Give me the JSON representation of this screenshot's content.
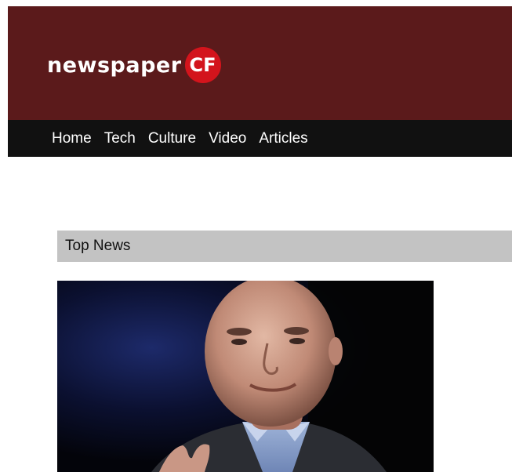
{
  "masthead": {
    "logo_word": "newspaper",
    "logo_badge": "CF",
    "colors": {
      "background": "#5b1a1b",
      "badge": "#d3141c",
      "text": "#ffffff"
    }
  },
  "nav": {
    "items": [
      {
        "label": "Home"
      },
      {
        "label": "Tech"
      },
      {
        "label": "Culture"
      },
      {
        "label": "Video"
      },
      {
        "label": "Articles"
      }
    ],
    "colors": {
      "background": "#111111",
      "text": "#ffffff"
    }
  },
  "top_news": {
    "title": "Top News",
    "bar_color": "#c3c3c3",
    "hero_image": {
      "icon": "news-photo-portrait"
    }
  }
}
